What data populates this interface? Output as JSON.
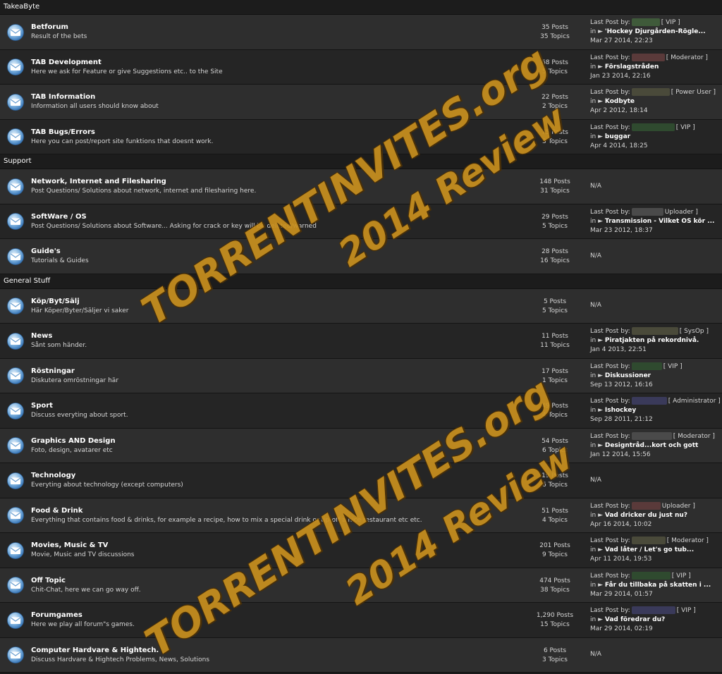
{
  "sections": [
    {
      "title": "TakeaByte"
    },
    {
      "title": "Support"
    },
    {
      "title": "General Stuff"
    }
  ],
  "forums": [
    {
      "title": "Betforum",
      "desc": "Result of the bets",
      "posts": "35 Posts",
      "topics": "35 Topics",
      "last": {
        "label": "Last Post by:",
        "role": "[ VIP ]",
        "in": "in ►",
        "topic": "'Hockey Djurgården-Rögle...",
        "date": "Mar 27 2014, 22:23"
      }
    },
    {
      "title": "TAB Development",
      "desc": "Here we ask for Feature or give Suggestions etc.. to the Site",
      "posts": "68 Posts",
      "topics": "5 Topics",
      "last": {
        "label": "Last Post by:",
        "role": "[ Moderator ]",
        "in": "in ►",
        "topic": "Förslagstråden",
        "date": "Jan 23 2014, 22:16"
      }
    },
    {
      "title": "TAB Information",
      "desc": "Information all users should know about",
      "posts": "22 Posts",
      "topics": "2 Topics",
      "last": {
        "label": "Last Post by:",
        "role": "[ Power User ]",
        "in": "in ►",
        "topic": "Kodbyte",
        "date": "Apr 2 2012, 18:14"
      }
    },
    {
      "title": "TAB Bugs/Errors",
      "desc": "Here you can post/report site funktions that doesnt work.",
      "posts": "75 Posts",
      "topics": "3 Topics",
      "last": {
        "label": "Last Post by:",
        "role": "[ VIP ]",
        "in": "in ►",
        "topic": "buggar",
        "date": "Apr 4 2014, 18:25"
      }
    },
    {
      "title": "Network, Internet and Filesharing",
      "desc": "Post Questions/ Solutions about network, internet and filesharing here.",
      "posts": "148 Posts",
      "topics": "31 Topics",
      "na": "N/A"
    },
    {
      "title": "SoftWare / OS",
      "desc": "Post Questions/ Solutions about Software... Asking for crack or key will be deleted/warned",
      "posts": "29 Posts",
      "topics": "5 Topics",
      "last": {
        "label": "Last Post by:",
        "role": "Uploader ]",
        "in": "in ►",
        "topic": "Transmission - Vilket OS kör ...",
        "date": "Mar 23 2012, 18:37"
      }
    },
    {
      "title": "Guide's",
      "desc": "Tutorials & Guides",
      "posts": "28 Posts",
      "topics": "16 Topics",
      "na": "N/A"
    },
    {
      "title": "Köp/Byt/Sälj",
      "desc": "Här Köper/Byter/Säljer vi saker",
      "posts": "5 Posts",
      "topics": "5 Topics",
      "na": "N/A"
    },
    {
      "title": "News",
      "desc": "Sånt som händer.",
      "posts": "11 Posts",
      "topics": "11 Topics",
      "last": {
        "label": "Last Post by:",
        "role": "[ SysOp ]",
        "in": "in ►",
        "topic": "Piratjakten på rekordnivå.",
        "date": "Jan 4 2013, 22:51"
      }
    },
    {
      "title": "Röstningar",
      "desc": "Diskutera omröstningar här",
      "posts": "17 Posts",
      "topics": "1 Topics",
      "last": {
        "label": "Last Post by:",
        "role": "[ VIP ]",
        "in": "in ►",
        "topic": "Diskussioner",
        "date": "Sep 13 2012, 16:16"
      }
    },
    {
      "title": "Sport",
      "desc": "Discuss everyting about sport.",
      "posts": "49 Posts",
      "topics": "4 Topics",
      "last": {
        "label": "Last Post by:",
        "role": "[ Administrator ]",
        "in": "in ►",
        "topic": "Ishockey",
        "date": "Sep 28 2011, 21:12"
      }
    },
    {
      "title": "Graphics AND Design",
      "desc": "Foto, design, avatarer etc",
      "posts": "54 Posts",
      "topics": "6 Topics",
      "last": {
        "label": "Last Post by:",
        "role": "[ Moderator ]",
        "in": "in ►",
        "topic": "Designtråd...kort och gott",
        "date": "Jan 12 2014, 15:56"
      }
    },
    {
      "title": "Technology",
      "desc": "Everyting about technology (except computers)",
      "posts": "19 Posts",
      "topics": "6 Topics",
      "na": "N/A"
    },
    {
      "title": "Food & Drink",
      "desc": "Everything that contains food & drinks, for example a recipe, how to mix a special drink or tip-off a nice restaurant etc etc.",
      "posts": "51 Posts",
      "topics": "4 Topics",
      "last": {
        "label": "Last Post by:",
        "role": "Uploader ]",
        "in": "in ►",
        "topic": "Vad dricker du just nu?",
        "date": "Apr 16 2014, 10:02"
      }
    },
    {
      "title": "Movies, Music & TV",
      "desc": "Movie, Music and TV discussions",
      "posts": "201 Posts",
      "topics": "9 Topics",
      "last": {
        "label": "Last Post by:",
        "role": "[ Moderator ]",
        "in": "in ►",
        "topic": "Vad låter / Let's go tub...",
        "date": "Apr 11 2014, 19:53"
      }
    },
    {
      "title": "Off Topic",
      "desc": "Chit-Chat, here we can go way off.",
      "posts": "474 Posts",
      "topics": "38 Topics",
      "last": {
        "label": "Last Post by:",
        "role": "[ VIP ]",
        "in": "in ►",
        "topic": "Får du tillbaka på skatten i ...",
        "date": "Mar 29 2014, 01:57"
      }
    },
    {
      "title": "Forumgames",
      "desc": "Here we play all forum\"s games.",
      "posts": "1,290 Posts",
      "topics": "15 Topics",
      "last": {
        "label": "Last Post by:",
        "role": "[ VIP ]",
        "in": "in ►",
        "topic": "Vad föredrar du?",
        "date": "Mar 29 2014, 02:19"
      }
    },
    {
      "title": "Computer Hardvare & Hightech.",
      "desc": "Discuss Hardvare & Hightech Problems, News, Solutions",
      "posts": "6 Posts",
      "topics": "3 Topics",
      "na": "N/A"
    }
  ],
  "watermark": {
    "line1": "TORRENTINVITES.org",
    "line2": "2014 Review"
  },
  "colors": {
    "row_a": "#2e2e2e",
    "row_b": "#252525",
    "header": "#1c1c1c",
    "watermark": "#c9901e",
    "icon": "#5b9bd5"
  },
  "icon": "mail-envelope-icon"
}
